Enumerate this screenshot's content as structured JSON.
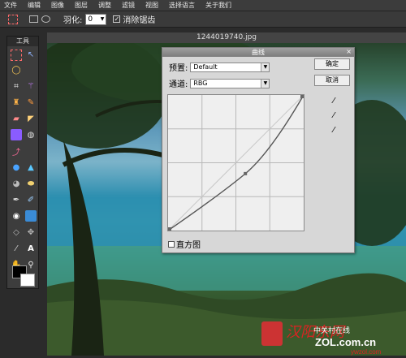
{
  "menu": [
    "文件",
    "编辑",
    "图像",
    "图层",
    "调整",
    "滤镜",
    "视图",
    "选择语言",
    "关于我们"
  ],
  "options": {
    "feather_label": "羽化:",
    "feather_value": "0",
    "antialias_label": "消除锯齿",
    "antialias_checked": "✓"
  },
  "toolbox": {
    "title": "工具"
  },
  "document": {
    "filename": "1244019740.jpg"
  },
  "curves_dialog": {
    "title": "曲线",
    "close": "×",
    "preset_label": "预置:",
    "preset_value": "Default",
    "channel_label": "通道:",
    "channel_value": "RBG",
    "ok_label": "确定",
    "cancel_label": "取消",
    "histogram_label": "直方图",
    "curve_points": [
      [
        0,
        0
      ],
      [
        0.57,
        0.42
      ],
      [
        1,
        1
      ]
    ]
  },
  "watermark": {
    "left_text": "汉阳东网",
    "brand": "中关村在线",
    "url": "ZOL.com.cn",
    "right_text": "ywzol.com"
  }
}
